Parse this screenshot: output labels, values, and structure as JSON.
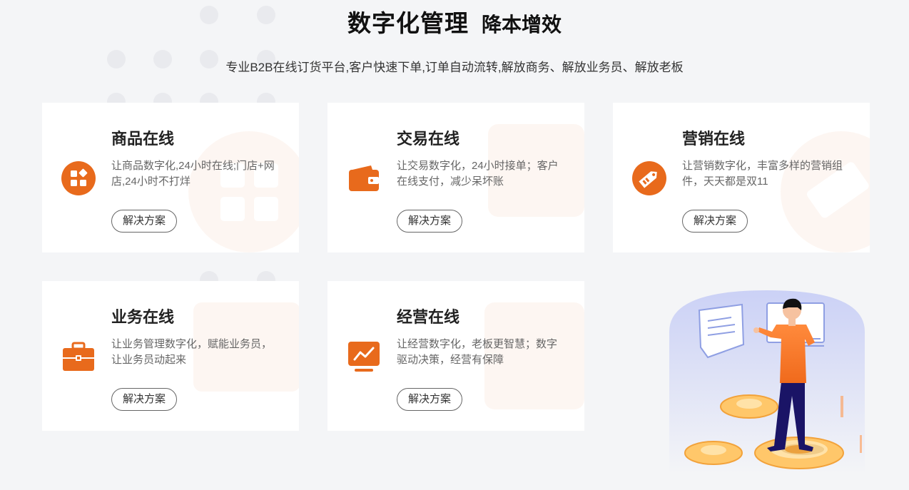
{
  "header": {
    "title_main": "数字化管理",
    "title_sub": "降本增效",
    "subtitle": "专业B2B在线订货平台,客户快速下单,订单自动流转,解放商务、解放业务员、解放老板"
  },
  "cards": [
    {
      "title": "商品在线",
      "desc": "让商品数字化,24小时在线;门店+网店,24小时不打烊",
      "button": "解决方案",
      "icon": "grid-apps-icon"
    },
    {
      "title": "交易在线",
      "desc": "让交易数字化，24小时接单；客户在线支付，减少呆坏账",
      "button": "解决方案",
      "icon": "wallet-icon"
    },
    {
      "title": "营销在线",
      "desc": "让营销数字化，丰富多样的营销组件，天天都是双11",
      "button": "解决方案",
      "icon": "price-tag-icon"
    },
    {
      "title": "业务在线",
      "desc": "让业务管理数字化，赋能业务员，让业务员动起来",
      "button": "解决方案",
      "icon": "briefcase-icon"
    },
    {
      "title": "经营在线",
      "desc": "让经营数字化，老板更智慧；数字驱动决策，经营有保障",
      "button": "解决方案",
      "icon": "trend-monitor-icon"
    }
  ],
  "colors": {
    "accent": "#e86a1c",
    "background": "#f4f5f7",
    "card": "#ffffff"
  }
}
